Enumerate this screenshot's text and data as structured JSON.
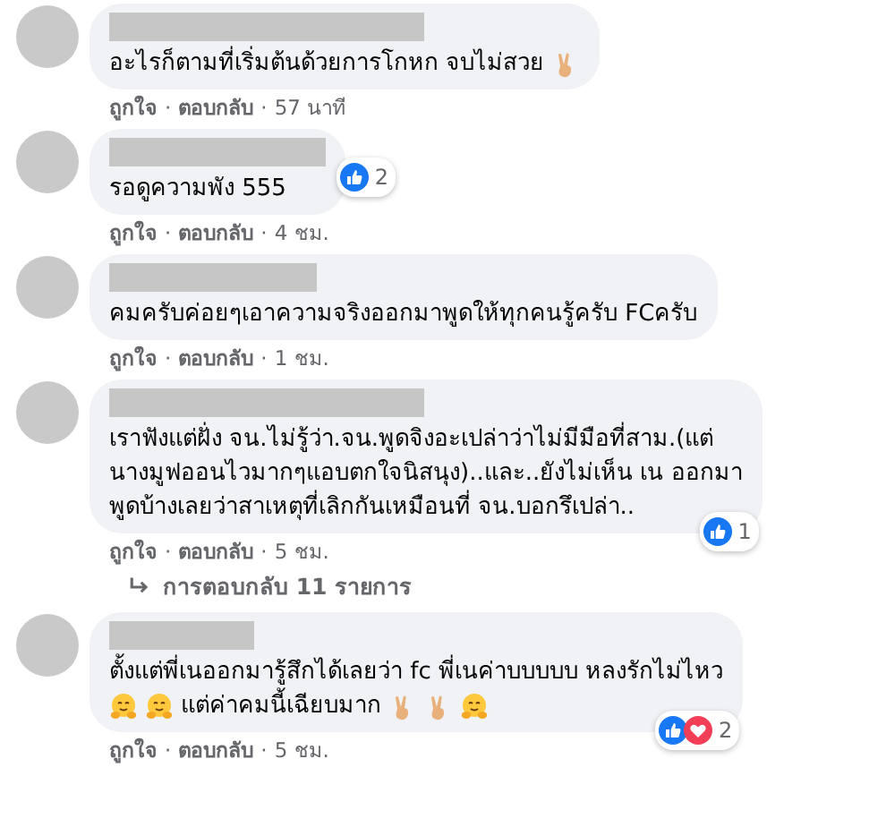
{
  "comments": [
    {
      "lines": [
        [
          {
            "kind": "text",
            "text": "อะไรก็ตามที่เริ่มต้นด้วยการโกหก จบไม่สวย"
          },
          {
            "kind": "peace"
          }
        ]
      ],
      "actions": [
        {
          "kind": "link",
          "text": "ถูกใจ"
        },
        {
          "kind": "sep",
          "text": "·"
        },
        {
          "kind": "link",
          "text": "ตอบกลับ"
        },
        {
          "kind": "sep",
          "text": "·"
        },
        {
          "kind": "time",
          "text": "57 นาที"
        }
      ]
    },
    {
      "lines": [
        [
          {
            "kind": "text",
            "text": "รอดูความพัง 555"
          }
        ]
      ],
      "reactions": {
        "icons": [
          {
            "kind": "like"
          }
        ],
        "count": "2"
      },
      "actions": [
        {
          "kind": "link",
          "text": "ถูกใจ"
        },
        {
          "kind": "sep",
          "text": "·"
        },
        {
          "kind": "link",
          "text": "ตอบกลับ"
        },
        {
          "kind": "sep",
          "text": "·"
        },
        {
          "kind": "time",
          "text": "4 ชม."
        }
      ]
    },
    {
      "lines": [
        [
          {
            "kind": "text",
            "text": "คมครับค่อยๆเอาความจริงออกมาพูดให้ทุกคนรู้ครับ FCครับ"
          }
        ]
      ],
      "actions": [
        {
          "kind": "link",
          "text": "ถูกใจ"
        },
        {
          "kind": "sep",
          "text": "·"
        },
        {
          "kind": "link",
          "text": "ตอบกลับ"
        },
        {
          "kind": "sep",
          "text": "·"
        },
        {
          "kind": "time",
          "text": "1 ชม."
        }
      ]
    },
    {
      "lines": [
        [
          {
            "kind": "text",
            "text": "เราฟังแต่ฝั่ง จน.ไม่รู้ว่า.จน.พูดจิงอะเปล่าว่าไม่มีมือที่สาม.(แต่"
          }
        ],
        [
          {
            "kind": "text",
            "text": "นางมูฟออนไวมากๆแอบตกใจนิสนุง)..และ..ยังไม่เห็น เน ออกมา"
          }
        ],
        [
          {
            "kind": "text",
            "text": "พูดบ้างเลยว่าสาเหตุที่เลิกกันเหมือนที่ จน.บอกรึเปล่า.."
          }
        ]
      ],
      "reactions": {
        "icons": [
          {
            "kind": "like"
          }
        ],
        "count": "1"
      },
      "actions": [
        {
          "kind": "link",
          "text": "ถูกใจ"
        },
        {
          "kind": "sep",
          "text": "·"
        },
        {
          "kind": "link",
          "text": "ตอบกลับ"
        },
        {
          "kind": "sep",
          "text": "·"
        },
        {
          "kind": "time",
          "text": "5 ชม."
        }
      ],
      "replies": "การตอบกลับ 11 รายการ"
    },
    {
      "lines": [
        [
          {
            "kind": "text",
            "text": "ตั้งแต่พี่เนออกมารู้สึกได้เลยว่า fc พี่เนค่าบบบบบ หลงรักไม่ไหว"
          }
        ],
        [
          {
            "kind": "hug"
          },
          {
            "kind": "hug"
          },
          {
            "kind": "text",
            "text": "แต่ค่าคมนี้เฉียบมาก"
          },
          {
            "kind": "peace"
          },
          {
            "kind": "peace"
          },
          {
            "kind": "hug"
          }
        ]
      ],
      "reactions": {
        "icons": [
          {
            "kind": "like"
          },
          {
            "kind": "love"
          }
        ],
        "count": "2"
      },
      "actions": [
        {
          "kind": "link",
          "text": "ถูกใจ"
        },
        {
          "kind": "sep",
          "text": "·"
        },
        {
          "kind": "link",
          "text": "ตอบกลับ"
        },
        {
          "kind": "sep",
          "text": "·"
        },
        {
          "kind": "time",
          "text": "5 ชม."
        }
      ]
    }
  ]
}
